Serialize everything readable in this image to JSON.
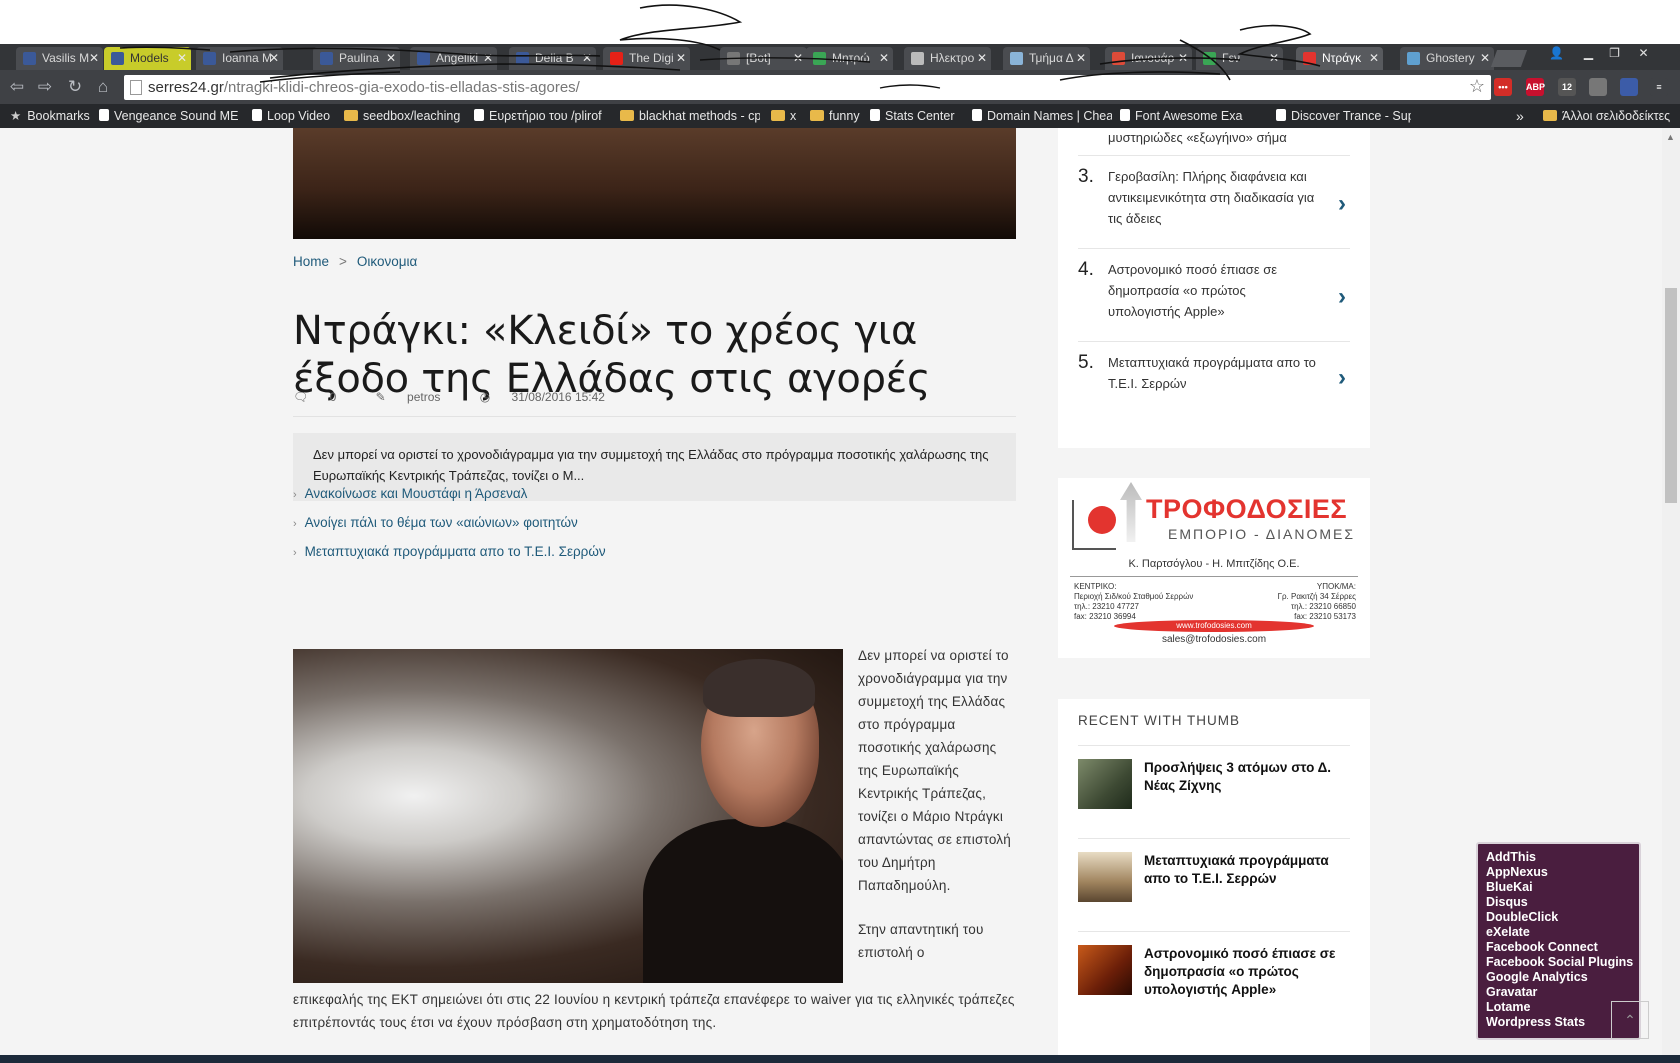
{
  "browser": {
    "tabs": [
      {
        "label": "Vasilis M",
        "fav_color": "#3b5998"
      },
      {
        "label": "Models",
        "fav_color": "#3b5998"
      },
      {
        "label": "Ioanna M",
        "fav_color": "#3b5998"
      },
      {
        "label": "Paulina",
        "fav_color": "#3b5998"
      },
      {
        "label": "Angeliki",
        "fav_color": "#3b5998"
      },
      {
        "label": "Delia B",
        "fav_color": "#3b5998"
      },
      {
        "label": "The Digi",
        "fav_color": "#e62117"
      },
      {
        "label": "[Bot]",
        "fav_color": "#777777"
      },
      {
        "label": "Μητρώ",
        "fav_color": "#3aa655"
      },
      {
        "label": "Ηλεκτρο",
        "fav_color": "#bbbbbb"
      },
      {
        "label": "Τμήμα Δ",
        "fav_color": "#8ab4d8"
      },
      {
        "label": "Ιανουάρ",
        "fav_color": "#dd4b39"
      },
      {
        "label": "Γεν",
        "fav_color": "#3aa655"
      },
      {
        "label": "Ντράγκ",
        "fav_color": "#e3342f"
      },
      {
        "label": "Ghostery",
        "fav_color": "#5fa0d0"
      }
    ],
    "url_domain": "serres24.gr",
    "url_path": "/ntragki-klidi-chreos-gia-exodo-tis-elladas-stis-agores/",
    "extensions": [
      {
        "name": "lastpass-icon",
        "label": "•••",
        "color": "#d32d27"
      },
      {
        "name": "adblock-icon",
        "label": "ABP",
        "color": "#c8102e"
      },
      {
        "name": "ghostery-icon",
        "label": "12",
        "color": "#555555"
      },
      {
        "name": "extension-icon",
        "label": "",
        "color": "#777777"
      },
      {
        "name": "flag-icon",
        "label": "",
        "color": "#3c5ca8"
      },
      {
        "name": "menu-icon",
        "label": "≡",
        "color": "#3f4145"
      }
    ],
    "bookmarks": [
      {
        "label": "Bookmarks",
        "icon": "star"
      },
      {
        "label": "Vengeance Sound ME",
        "icon": "page"
      },
      {
        "label": "Loop Video",
        "icon": "page"
      },
      {
        "label": "seedbox/leaching",
        "icon": "folder"
      },
      {
        "label": "Ευρετήριο του /plirof",
        "icon": "page"
      },
      {
        "label": "blackhat methods - cp",
        "icon": "folder"
      },
      {
        "label": "x",
        "icon": "folder"
      },
      {
        "label": "funny",
        "icon": "folder"
      },
      {
        "label": "Stats Center",
        "icon": "page"
      },
      {
        "label": "Domain Names | Chea",
        "icon": "page"
      },
      {
        "label": "Font Awesome Exa",
        "icon": "page"
      },
      {
        "label": "Discover Trance - Sup",
        "icon": "page"
      }
    ],
    "bookmarks_more": "»",
    "other_bookmarks": "Άλλοι σελιδοδείκτες"
  },
  "breadcrumb": {
    "home": "Home",
    "separator": ">",
    "category": "Οικονομια"
  },
  "article": {
    "title": "Ντράγκι: «Κλειδί» το χρέος για έξοδο της Ελλάδας στις αγορές",
    "comments": "0",
    "author": "petros",
    "date": "31/08/2016 15:42",
    "excerpt": "Δεν μπορεί να οριστεί το χρονοδιάγραμμα για την συμμετοχή της Ελλάδας στο πρόγραμμα ποσοτικής χαλάρωσης της Ευρωπαϊκής Κεντρικής Τράπεζας, τονίζει ο Μ...",
    "related": [
      "Ανακοίνωσε και Μουστάφι η Άρσεναλ",
      "Ανοίγει πάλι το θέμα των «αιώνιων» φοιτητών",
      "Μεταπτυχιακά προγράμματα απο το Τ.Ε.Ι. Σερρών"
    ],
    "body_p1": "Δεν μπορεί να οριστεί το χρονοδιάγραμμα για την συμμετοχή της Ελλάδας στο πρόγραμμα ποσοτικής χαλάρωσης της Ευρωπαϊκής Κεντρικής Τράπεζας, τονίζει ο Μάριο Ντράγκι απαντώντας σε επιστολή του Δημήτρη Παπαδημούλη.",
    "body_p2_start": "Στην απαντητική του επιστολή ο",
    "body_p2_rest": "επικεφαλής της ΕΚΤ σημειώνει ότι στις 22 Ιουνίου η κεντρική τράπεζα επανέφερε το waiver για τις ελληνικές τράπεζες επιτρέποντάς τους έτσι να έχουν πρόσβαση στη χρηματοδότηση της."
  },
  "sidebar": {
    "popular_top": "μυστηριώδες «εξωγήινο» σήμα",
    "popular": [
      {
        "num": "3.",
        "text": "Γεροβασίλη: Πλήρης διαφάνεια και αντικειμενικότητα στη διαδικασία για τις άδειες"
      },
      {
        "num": "4.",
        "text": "Αστρονομικό ποσό έπιασε σε δημοπρασία «ο πρώτος υπολογιστής Apple»"
      },
      {
        "num": "5.",
        "text": "Μεταπτυχιακά προγράμματα απο το Τ.Ε.Ι. Σερρών"
      }
    ],
    "ad": {
      "title": "ΤΡΟΦΟΔΟΣΙΕΣ",
      "subtitle": "ΕΜΠΟΡΙΟ - ΔΙΑΝΟΜΕΣ",
      "names": "Κ. Παρτσόγλου - Η. Μπιτζίδης Ο.Ε.",
      "left_block": "ΚΕΝΤΡΙΚΟ:\nΠεριοχή Σιδ/κού Σταθμού Σερρών\nτηλ.: 23210 47727\nfax: 23210 36994",
      "right_block": "ΥΠΟΚ/ΜΑ:\nΓρ. Ρακιτζή 34 Σέρρες\nτηλ.: 23210 66850\nfax: 23210 53173",
      "web": "www.trofodosies.com",
      "email": "sales@trofodosies.com"
    },
    "recent_heading": "RECENT WITH THUMB",
    "recent": [
      {
        "text": "Προσλήψεις 3 ατόμων στο Δ. Νέας Ζίχνης",
        "thumb": "linear-gradient(135deg,#7d8a6a,#3e4a34 60%,#1e2a1a)"
      },
      {
        "text": "Μεταπτυχιακά προγράμματα απο το Τ.Ε.Ι. Σερρών",
        "thumb": "linear-gradient(180deg,#e8dcc4,#a0845e 60%,#5a4630)"
      },
      {
        "text": "Αστρονομικό ποσό έπιασε σε δημοπρασία «ο πρώτος υπολογιστής Apple»",
        "thumb": "linear-gradient(135deg,#c85a1a,#6a1e08 60%,#2a0a02)"
      }
    ]
  },
  "ghostery": {
    "trackers": [
      "AddThis",
      "AppNexus",
      "BlueKai",
      "Disqus",
      "DoubleClick",
      "eXelate",
      "Facebook Connect",
      "Facebook Social Plugins",
      "Google Analytics",
      "Gravatar",
      "Lotame",
      "Wordpress Stats"
    ]
  }
}
